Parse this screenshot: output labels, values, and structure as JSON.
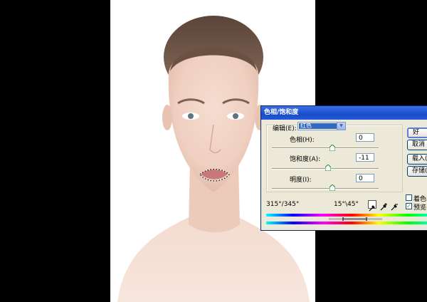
{
  "dialog": {
    "title": "色相/饱和度",
    "edit_label": "编辑(E):",
    "edit_value": "红色",
    "hue_label": "色相(H):",
    "hue_value": "0",
    "saturation_label": "饱和度(A):",
    "saturation_value": "-11",
    "lightness_label": "明度(I):",
    "lightness_value": "0",
    "range_left": "315°/345°",
    "range_right": "15°\\45°",
    "buttons": {
      "ok": "好",
      "cancel": "取消",
      "load": "载入(L)",
      "save": "存储(S)"
    },
    "colorize_label": "着色(O)",
    "preview_label": "预览(P)",
    "preview_checked": true,
    "colorize_checked": false
  },
  "icons": [
    "eyedropper-icon",
    "eyedropper-plus-icon",
    "eyedropper-minus-icon",
    "chevron-down-icon"
  ]
}
